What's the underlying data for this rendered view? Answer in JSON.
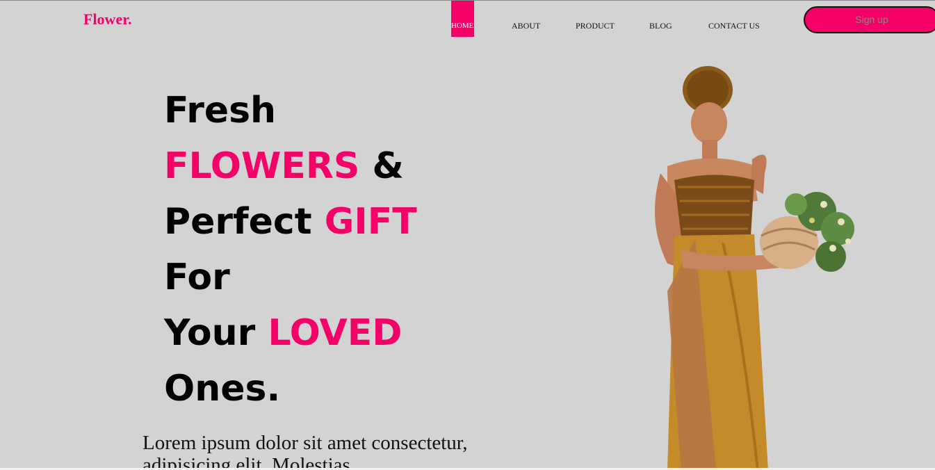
{
  "brand": {
    "logo": "Flower."
  },
  "nav": {
    "items": [
      {
        "label": "HOME",
        "active": true
      },
      {
        "label": "ABOUT",
        "active": false
      },
      {
        "label": "PRODUCT",
        "active": false
      },
      {
        "label": "BLOG",
        "active": false
      },
      {
        "label": "CONTACT US",
        "active": false
      }
    ],
    "signup_label": "Sign up"
  },
  "hero": {
    "line1": "Fresh",
    "line2_pink": "FLOWERS",
    "line2_rest": " &",
    "line3_start": "Perfect ",
    "line3_pink": "GIFT",
    "line4": "For",
    "line5_start": "Your ",
    "line5_pink": "LOVED",
    "line6": "Ones.",
    "description": "Lorem ipsum dolor sit amet consectetur, adipisicing elit. Molestias"
  },
  "image": {
    "icon": "woman-holding-flower-basket"
  },
  "colors": {
    "accent": "#f50067",
    "background": "#d3d3d3"
  }
}
